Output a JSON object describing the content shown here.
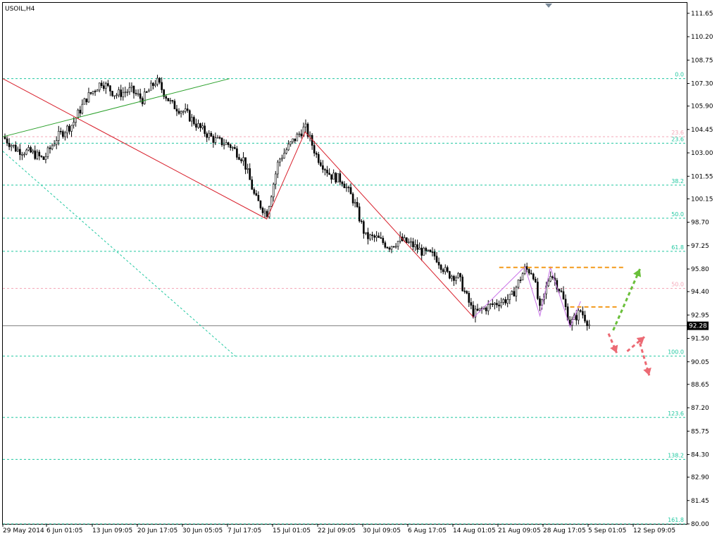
{
  "chart_data": {
    "type": "candlestick",
    "symbol_label": "USOIL,H4",
    "current_price": "92.28",
    "y_ticks": [
      "111.65",
      "110.20",
      "108.75",
      "107.30",
      "105.90",
      "104.45",
      "103.00",
      "101.55",
      "100.15",
      "98.70",
      "97.25",
      "95.80",
      "94.40",
      "92.95",
      "91.50",
      "90.05",
      "88.65",
      "87.20",
      "85.75",
      "84.30",
      "82.90",
      "81.45",
      "80.00"
    ],
    "x_ticks": [
      "29 May 2014",
      "6 Jun 01:05",
      "13 Jun 09:05",
      "20 Jun 17:05",
      "30 Jun 05:05",
      "7 Jul 17:05",
      "15 Jul 01:05",
      "22 Jul 09:05",
      "30 Jul 09:05",
      "6 Aug 17:05",
      "14 Aug 01:05",
      "21 Aug 09:05",
      "28 Aug 17:05",
      "5 Sep 01:05",
      "12 Sep 09:05"
    ],
    "fib_levels": [
      {
        "label": "0.0",
        "price": 107.6,
        "color": "#20c8a0"
      },
      {
        "label": "23.6",
        "price": 104.0,
        "color": "#f4a8b8"
      },
      {
        "label": "23.6",
        "price": 103.6,
        "color": "#20c8a0"
      },
      {
        "label": "38.2",
        "price": 101.0,
        "color": "#20c8a0"
      },
      {
        "label": "50.0",
        "price": 98.95,
        "color": "#20c8a0"
      },
      {
        "label": "61.8",
        "price": 96.9,
        "color": "#20c8a0"
      },
      {
        "label": "50.0",
        "price": 94.6,
        "color": "#f4a8b8"
      },
      {
        "label": "100.0",
        "price": 90.4,
        "color": "#20c8a0"
      },
      {
        "label": "123.6",
        "price": 86.6,
        "color": "#20c8a0"
      },
      {
        "label": "138.2",
        "price": 84.0,
        "color": "#20c8a0"
      },
      {
        "label": "161.8",
        "price": 80.0,
        "color": "#20c8a0"
      }
    ],
    "zigzag_red": [
      [
        0.0,
        107.6
      ],
      [
        0.227,
        98.9
      ],
      [
        0.26,
        104.3
      ],
      [
        0.405,
        92.8
      ]
    ],
    "zigzag_green": [
      [
        0.0,
        104.0
      ],
      [
        0.195,
        107.6
      ]
    ],
    "harmonic_violet": [
      [
        0.405,
        92.8
      ],
      [
        0.449,
        95.95
      ],
      [
        0.462,
        92.9
      ],
      [
        0.471,
        95.9
      ],
      [
        0.488,
        92.2
      ],
      [
        0.497,
        93.8
      ]
    ],
    "resistance_orange": [
      [
        0.427,
        95.9
      ],
      [
        0.536,
        95.9
      ]
    ],
    "resistance_orange_2": [
      [
        0.488,
        93.45
      ],
      [
        0.528,
        93.45
      ]
    ],
    "arrows": [
      {
        "from": [
          0.525,
          92.0
        ],
        "to": [
          0.548,
          95.8
        ],
        "color": "#6abf3a"
      },
      {
        "from": [
          0.521,
          91.8
        ],
        "to": [
          0.528,
          90.6
        ],
        "color": "#ec6a74"
      },
      {
        "from": [
          0.537,
          90.7
        ],
        "to": [
          0.552,
          91.6
        ],
        "color": "#ec6a74"
      },
      {
        "from": [
          0.548,
          91.2
        ],
        "to": [
          0.556,
          89.2
        ],
        "color": "#ec6a74"
      }
    ],
    "diag_dashed": [
      [
        0.0,
        103.1
      ],
      [
        0.2,
        90.4
      ]
    ],
    "ylim": [
      80.0,
      112.3
    ],
    "candles_seed": 7
  }
}
